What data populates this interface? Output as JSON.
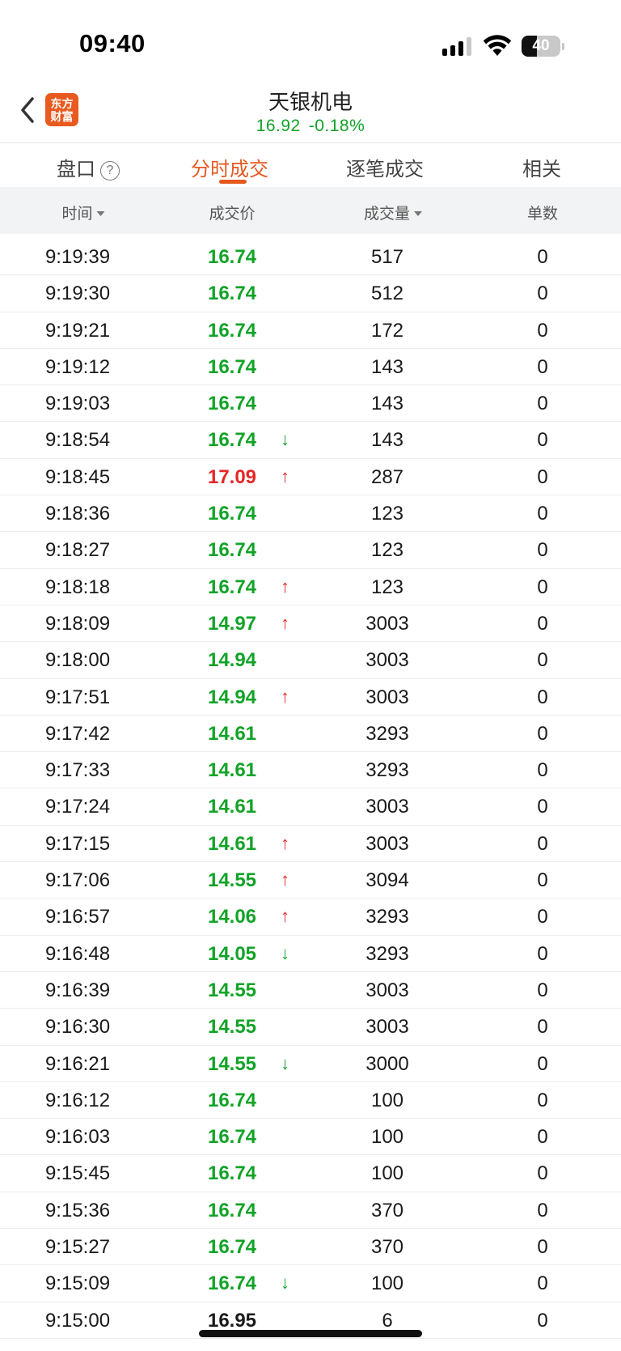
{
  "status_bar": {
    "time": "09:40",
    "battery": "40",
    "battery_level": 0.4
  },
  "header": {
    "stock_name": "天银机电",
    "price": "16.92",
    "change": "-0.18%",
    "logo_line1": "东方",
    "logo_line2": "财富",
    "colors": {
      "down": "#11a327",
      "up": "#e62626",
      "accent": "#e5581f"
    }
  },
  "tabs": [
    {
      "label": "盘口",
      "help": "?"
    },
    {
      "label": "分时成交",
      "active": true
    },
    {
      "label": "逐笔成交"
    },
    {
      "label": "相关"
    }
  ],
  "columns": [
    "时间",
    "成交价",
    "成交量",
    "单数"
  ],
  "rows": [
    {
      "time": "9:19:39",
      "price": "16.74",
      "color": "green",
      "arrow": "",
      "volume": "517",
      "count": "0"
    },
    {
      "time": "9:19:30",
      "price": "16.74",
      "color": "green",
      "arrow": "",
      "volume": "512",
      "count": "0"
    },
    {
      "time": "9:19:21",
      "price": "16.74",
      "color": "green",
      "arrow": "",
      "volume": "172",
      "count": "0"
    },
    {
      "time": "9:19:12",
      "price": "16.74",
      "color": "green",
      "arrow": "",
      "volume": "143",
      "count": "0"
    },
    {
      "time": "9:19:03",
      "price": "16.74",
      "color": "green",
      "arrow": "",
      "volume": "143",
      "count": "0"
    },
    {
      "time": "9:18:54",
      "price": "16.74",
      "color": "green",
      "arrow": "↓",
      "volume": "143",
      "count": "0"
    },
    {
      "time": "9:18:45",
      "price": "17.09",
      "color": "red",
      "arrow": "↑",
      "volume": "287",
      "count": "0"
    },
    {
      "time": "9:18:36",
      "price": "16.74",
      "color": "green",
      "arrow": "",
      "volume": "123",
      "count": "0"
    },
    {
      "time": "9:18:27",
      "price": "16.74",
      "color": "green",
      "arrow": "",
      "volume": "123",
      "count": "0"
    },
    {
      "time": "9:18:18",
      "price": "16.74",
      "color": "green",
      "arrow": "↑",
      "volume": "123",
      "count": "0"
    },
    {
      "time": "9:18:09",
      "price": "14.97",
      "color": "green",
      "arrow": "↑",
      "volume": "3003",
      "count": "0"
    },
    {
      "time": "9:18:00",
      "price": "14.94",
      "color": "green",
      "arrow": "",
      "volume": "3003",
      "count": "0"
    },
    {
      "time": "9:17:51",
      "price": "14.94",
      "color": "green",
      "arrow": "↑",
      "volume": "3003",
      "count": "0"
    },
    {
      "time": "9:17:42",
      "price": "14.61",
      "color": "green",
      "arrow": "",
      "volume": "3293",
      "count": "0"
    },
    {
      "time": "9:17:33",
      "price": "14.61",
      "color": "green",
      "arrow": "",
      "volume": "3293",
      "count": "0"
    },
    {
      "time": "9:17:24",
      "price": "14.61",
      "color": "green",
      "arrow": "",
      "volume": "3003",
      "count": "0"
    },
    {
      "time": "9:17:15",
      "price": "14.61",
      "color": "green",
      "arrow": "↑",
      "volume": "3003",
      "count": "0"
    },
    {
      "time": "9:17:06",
      "price": "14.55",
      "color": "green",
      "arrow": "↑",
      "volume": "3094",
      "count": "0"
    },
    {
      "time": "9:16:57",
      "price": "14.06",
      "color": "green",
      "arrow": "↑",
      "volume": "3293",
      "count": "0"
    },
    {
      "time": "9:16:48",
      "price": "14.05",
      "color": "green",
      "arrow": "↓",
      "volume": "3293",
      "count": "0"
    },
    {
      "time": "9:16:39",
      "price": "14.55",
      "color": "green",
      "arrow": "",
      "volume": "3003",
      "count": "0"
    },
    {
      "time": "9:16:30",
      "price": "14.55",
      "color": "green",
      "arrow": "",
      "volume": "3003",
      "count": "0"
    },
    {
      "time": "9:16:21",
      "price": "14.55",
      "color": "green",
      "arrow": "↓",
      "volume": "3000",
      "count": "0"
    },
    {
      "time": "9:16:12",
      "price": "16.74",
      "color": "green",
      "arrow": "",
      "volume": "100",
      "count": "0"
    },
    {
      "time": "9:16:03",
      "price": "16.74",
      "color": "green",
      "arrow": "",
      "volume": "100",
      "count": "0"
    },
    {
      "time": "9:15:45",
      "price": "16.74",
      "color": "green",
      "arrow": "",
      "volume": "100",
      "count": "0"
    },
    {
      "time": "9:15:36",
      "price": "16.74",
      "color": "green",
      "arrow": "",
      "volume": "370",
      "count": "0"
    },
    {
      "time": "9:15:27",
      "price": "16.74",
      "color": "green",
      "arrow": "",
      "volume": "370",
      "count": "0"
    },
    {
      "time": "9:15:09",
      "price": "16.74",
      "color": "green",
      "arrow": "↓",
      "volume": "100",
      "count": "0"
    },
    {
      "time": "9:15:00",
      "price": "16.95",
      "color": "black",
      "arrow": "",
      "volume": "6",
      "count": "0"
    }
  ]
}
